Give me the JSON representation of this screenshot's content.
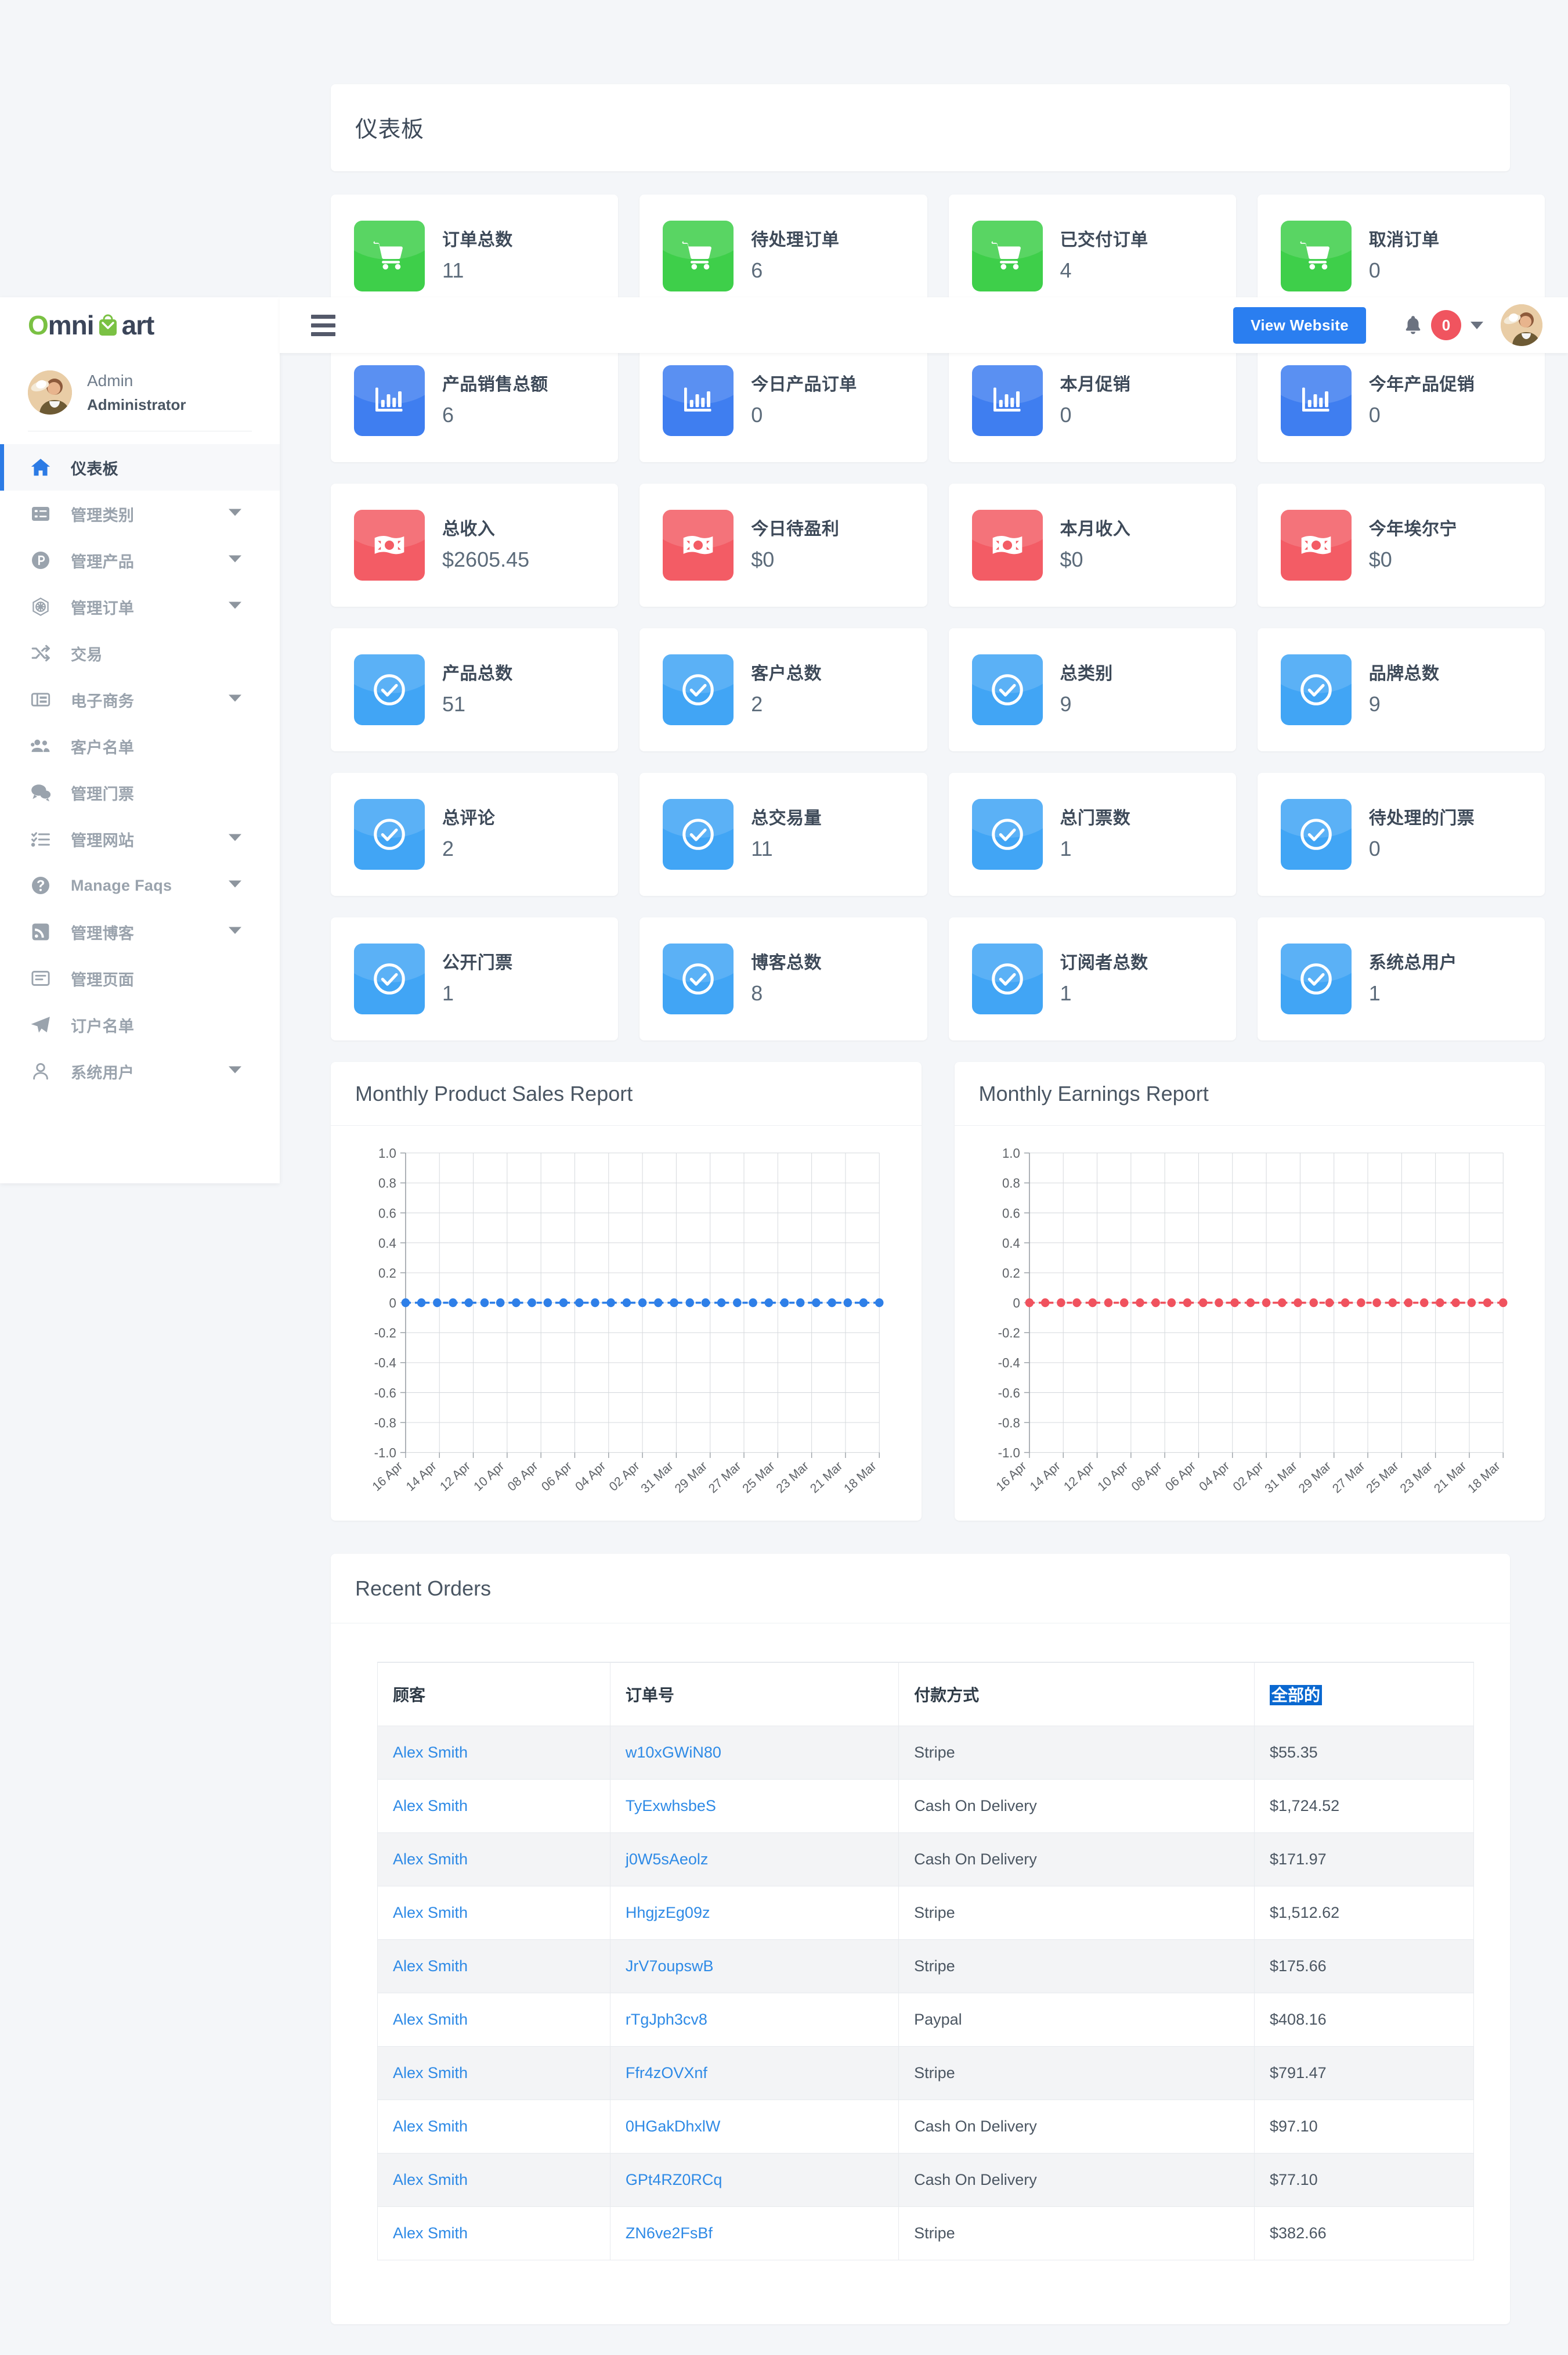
{
  "brand": {
    "part1": "Omni",
    "part2": "Mart",
    "o": "O",
    "mni": "mni",
    "art": "art"
  },
  "topbar": {
    "view_website_label": "View Website",
    "notification_count": "0"
  },
  "profile": {
    "name": "Admin",
    "role": "Administrator"
  },
  "sidebar": {
    "items": [
      {
        "label": "仪表板",
        "icon": "home-icon",
        "caret": false,
        "active": true
      },
      {
        "label": "管理类别",
        "icon": "list-icon",
        "caret": true,
        "active": false
      },
      {
        "label": "管理产品",
        "icon": "product-icon",
        "caret": true,
        "active": false
      },
      {
        "label": "管理订单",
        "icon": "orders-icon",
        "caret": true,
        "active": false
      },
      {
        "label": "交易",
        "icon": "shuffle-icon",
        "caret": false,
        "active": false
      },
      {
        "label": "电子商务",
        "icon": "ecommerce-icon",
        "caret": true,
        "active": false
      },
      {
        "label": "客户名单",
        "icon": "users-icon",
        "caret": false,
        "active": false
      },
      {
        "label": "管理门票",
        "icon": "chat-icon",
        "caret": false,
        "active": false
      },
      {
        "label": "管理网站",
        "icon": "tasks-icon",
        "caret": true,
        "active": false
      },
      {
        "label": "Manage Faqs",
        "icon": "question-icon",
        "caret": true,
        "active": false
      },
      {
        "label": "管理博客",
        "icon": "rss-icon",
        "caret": true,
        "active": false
      },
      {
        "label": "管理页面",
        "icon": "page-icon",
        "caret": false,
        "active": false
      },
      {
        "label": "订户名单",
        "icon": "send-icon",
        "caret": false,
        "active": false
      },
      {
        "label": "系统用户",
        "icon": "user-icon",
        "caret": true,
        "active": false
      }
    ]
  },
  "page": {
    "title": "仪表板"
  },
  "stats": [
    {
      "label": "订单总数",
      "value": "11",
      "color": "ic-green",
      "icon": "cart-icon"
    },
    {
      "label": "待处理订单",
      "value": "6",
      "color": "ic-green",
      "icon": "cart-icon"
    },
    {
      "label": "已交付订单",
      "value": "4",
      "color": "ic-green",
      "icon": "cart-icon"
    },
    {
      "label": "取消订单",
      "value": "0",
      "color": "ic-green",
      "icon": "cart-icon"
    },
    {
      "label": "产品销售总额",
      "value": "6",
      "color": "ic-blue",
      "icon": "bar-chart-icon"
    },
    {
      "label": "今日产品订单",
      "value": "0",
      "color": "ic-blue",
      "icon": "bar-chart-icon"
    },
    {
      "label": "本月促销",
      "value": "0",
      "color": "ic-blue",
      "icon": "bar-chart-icon"
    },
    {
      "label": "今年产品促销",
      "value": "0",
      "color": "ic-blue",
      "icon": "bar-chart-icon"
    },
    {
      "label": "总收入",
      "value": "$2605.45",
      "color": "ic-red",
      "icon": "money-icon"
    },
    {
      "label": "今日待盈利",
      "value": "$0",
      "color": "ic-red",
      "icon": "money-icon"
    },
    {
      "label": "本月收入",
      "value": "$0",
      "color": "ic-red",
      "icon": "money-icon"
    },
    {
      "label": "今年埃尔宁",
      "value": "$0",
      "color": "ic-red",
      "icon": "money-icon"
    },
    {
      "label": "产品总数",
      "value": "51",
      "color": "ic-sky",
      "icon": "check-circle-icon"
    },
    {
      "label": "客户总数",
      "value": "2",
      "color": "ic-sky",
      "icon": "check-circle-icon"
    },
    {
      "label": "总类别",
      "value": "9",
      "color": "ic-sky",
      "icon": "check-circle-icon"
    },
    {
      "label": "品牌总数",
      "value": "9",
      "color": "ic-sky",
      "icon": "check-circle-icon"
    },
    {
      "label": "总评论",
      "value": "2",
      "color": "ic-sky",
      "icon": "check-circle-icon"
    },
    {
      "label": "总交易量",
      "value": "11",
      "color": "ic-sky",
      "icon": "check-circle-icon"
    },
    {
      "label": "总门票数",
      "value": "1",
      "color": "ic-sky",
      "icon": "check-circle-icon"
    },
    {
      "label": "待处理的门票",
      "value": "0",
      "color": "ic-sky",
      "icon": "check-circle-icon"
    },
    {
      "label": "公开门票",
      "value": "1",
      "color": "ic-sky",
      "icon": "check-circle-icon"
    },
    {
      "label": "博客总数",
      "value": "8",
      "color": "ic-sky",
      "icon": "check-circle-icon"
    },
    {
      "label": "订阅者总数",
      "value": "1",
      "color": "ic-sky",
      "icon": "check-circle-icon"
    },
    {
      "label": "系统总用户",
      "value": "1",
      "color": "ic-sky",
      "icon": "check-circle-icon"
    }
  ],
  "chart_data": [
    {
      "type": "line",
      "title": "Monthly Product Sales Report",
      "xlabel": "",
      "ylabel": "",
      "ylim": [
        -1.0,
        1.0
      ],
      "yticks": [
        "1.0",
        "0.8",
        "0.6",
        "0.4",
        "0.2",
        "0",
        "-0.2",
        "-0.4",
        "-0.6",
        "-0.8",
        "-1.0"
      ],
      "xticks": [
        "16 Apr",
        "14 Apr",
        "12 Apr",
        "10 Apr",
        "08 Apr",
        "06 Apr",
        "04 Apr",
        "02 Apr",
        "31 Mar",
        "29 Mar",
        "27 Mar",
        "25 Mar",
        "23 Mar",
        "21 Mar",
        "18 Mar"
      ],
      "n_points": 31,
      "values": [
        0,
        0,
        0,
        0,
        0,
        0,
        0,
        0,
        0,
        0,
        0,
        0,
        0,
        0,
        0,
        0,
        0,
        0,
        0,
        0,
        0,
        0,
        0,
        0,
        0,
        0,
        0,
        0,
        0,
        0,
        0
      ],
      "color": "#2e7fe8",
      "grid": true,
      "legend": "none"
    },
    {
      "type": "line",
      "title": "Monthly Earnings Report",
      "xlabel": "",
      "ylabel": "",
      "ylim": [
        -1.0,
        1.0
      ],
      "yticks": [
        "1.0",
        "0.8",
        "0.6",
        "0.4",
        "0.2",
        "0",
        "-0.2",
        "-0.4",
        "-0.6",
        "-0.8",
        "-1.0"
      ],
      "xticks": [
        "16 Apr",
        "14 Apr",
        "12 Apr",
        "10 Apr",
        "08 Apr",
        "06 Apr",
        "04 Apr",
        "02 Apr",
        "31 Mar",
        "29 Mar",
        "27 Mar",
        "25 Mar",
        "23 Mar",
        "21 Mar",
        "18 Mar"
      ],
      "n_points": 31,
      "values": [
        0,
        0,
        0,
        0,
        0,
        0,
        0,
        0,
        0,
        0,
        0,
        0,
        0,
        0,
        0,
        0,
        0,
        0,
        0,
        0,
        0,
        0,
        0,
        0,
        0,
        0,
        0,
        0,
        0,
        0,
        0
      ],
      "color": "#f0525e",
      "grid": true,
      "legend": "none"
    }
  ],
  "orders": {
    "title": "Recent Orders",
    "columns": [
      "顾客",
      "订单号",
      "付款方式",
      "全部的"
    ],
    "selected_column_index": 3,
    "rows": [
      {
        "customer": "Alex Smith",
        "order_no": "w10xGWiN80",
        "payment": "Stripe",
        "total": "$55.35"
      },
      {
        "customer": "Alex Smith",
        "order_no": "TyExwhsbeS",
        "payment": "Cash On Delivery",
        "total": "$1,724.52"
      },
      {
        "customer": "Alex Smith",
        "order_no": "j0W5sAeolz",
        "payment": "Cash On Delivery",
        "total": "$171.97"
      },
      {
        "customer": "Alex Smith",
        "order_no": "HhgjzEg09z",
        "payment": "Stripe",
        "total": "$1,512.62"
      },
      {
        "customer": "Alex Smith",
        "order_no": "JrV7oupswB",
        "payment": "Stripe",
        "total": "$175.66"
      },
      {
        "customer": "Alex Smith",
        "order_no": "rTgJph3cv8",
        "payment": "Paypal",
        "total": "$408.16"
      },
      {
        "customer": "Alex Smith",
        "order_no": "Ffr4zOVXnf",
        "payment": "Stripe",
        "total": "$791.47"
      },
      {
        "customer": "Alex Smith",
        "order_no": "0HGakDhxlW",
        "payment": "Cash On Delivery",
        "total": "$97.10"
      },
      {
        "customer": "Alex Smith",
        "order_no": "GPt4RZ0RCq",
        "payment": "Cash On Delivery",
        "total": "$77.10"
      },
      {
        "customer": "Alex Smith",
        "order_no": "ZN6ve2FsBf",
        "payment": "Stripe",
        "total": "$382.66"
      }
    ]
  },
  "colors": {
    "accent_blue": "#2a7ef0",
    "green": "#3ecf4a",
    "red": "#f35c65",
    "sky": "#41a5f5",
    "page_bg": "#f4f6f9"
  }
}
